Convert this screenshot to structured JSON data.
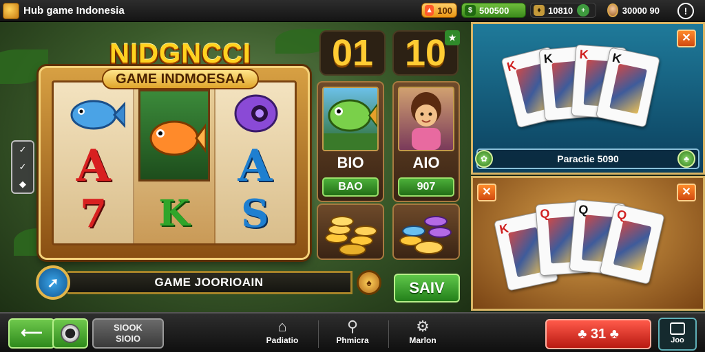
{
  "header": {
    "title": "Hub game Indonesia",
    "currency_1": "100",
    "currency_2": "500500",
    "currency_3": "10810",
    "balance": "30000 90"
  },
  "logo": {
    "title": "NIDGNCCI",
    "subtitle": "GAME INDMOESAA"
  },
  "reels": [
    {
      "top": "fish-blue",
      "mid": "A",
      "bot": "7"
    },
    {
      "top": "fish-orange",
      "mid": "",
      "bot": "K"
    },
    {
      "top": "orb-purple",
      "mid": "A",
      "bot": "S"
    }
  ],
  "search": {
    "value": "GAME JOORIOAIN"
  },
  "scores": {
    "left": "01",
    "right": "10"
  },
  "characters": [
    {
      "name": "fish",
      "value": "BIO",
      "button": "BAO"
    },
    {
      "name": "girl",
      "value": "AIO",
      "button": "907"
    }
  ],
  "say_button": "SAIV",
  "right_panel": {
    "label": "Paractie 5090",
    "cards_top": [
      "K",
      "K",
      "K",
      "K"
    ],
    "cards_bottom": [
      "K",
      "Q",
      "Q",
      "Q"
    ]
  },
  "bottom_nav": {
    "stock_line1": "SIOOK",
    "stock_line2": "SIOIO",
    "items": [
      {
        "label": "Padiatio"
      },
      {
        "label": "Phmicra"
      },
      {
        "label": "Marlon"
      }
    ],
    "score_label": "31",
    "job_label": "Joo"
  },
  "colors": {
    "gold": "#ffcc33",
    "green_button": "#3a9a28",
    "red_button": "#d22a1e"
  }
}
